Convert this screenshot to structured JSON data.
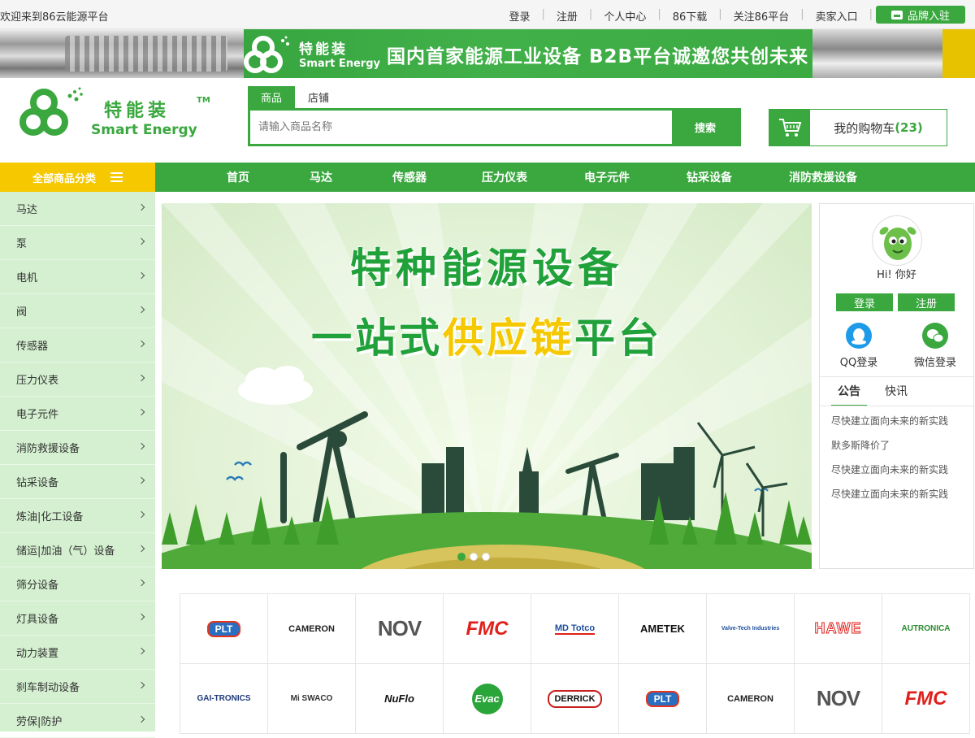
{
  "topbar": {
    "welcome": "欢迎来到86云能源平台",
    "links": [
      "登录",
      "注册",
      "个人中心",
      "86下载",
      "关注86平台",
      "卖家入口"
    ],
    "brand_join": "品牌入驻"
  },
  "top_banner": {
    "brand_cn": "特能装",
    "brand_en": "Smart Energy",
    "slogan": "国内首家能源工业设备 B2B平台诚邀您共创未来"
  },
  "logo": {
    "brand_cn": "特能装",
    "brand_en": "Smart Energy",
    "tm": "TM"
  },
  "search": {
    "tabs": [
      "商品",
      "店铺"
    ],
    "active_tab": 0,
    "placeholder": "请输入商品名称",
    "button": "搜索"
  },
  "cart": {
    "label": "我的购物车",
    "count": "(23)"
  },
  "nav": {
    "all_categories": "全部商品分类",
    "items": [
      "首页",
      "马达",
      "传感器",
      "压力仪表",
      "电子元件",
      "钻采设备",
      "消防救援设备"
    ]
  },
  "sidebar": {
    "categories": [
      "马达",
      "泵",
      "电机",
      "阀",
      "传感器",
      "压力仪表",
      "电子元件",
      "消防救援设备",
      "钻采设备",
      "炼油|化工设备",
      "储运|加油（气）设备",
      "筛分设备",
      "灯具设备",
      "动力装置",
      "刹车制动设备",
      "劳保|防护"
    ]
  },
  "hero": {
    "title_line1": "特种能源设备",
    "title_line2_a": "一站式",
    "title_line2_b": "供应链",
    "title_line2_c": "平台",
    "slides": 3,
    "active_slide": 0
  },
  "user_panel": {
    "greeting": "Hi!  你好",
    "login": "登录",
    "register": "注册",
    "qq_login": "QQ登录",
    "wechat_login": "微信登录",
    "tabs": [
      "公告",
      "快讯"
    ],
    "news": [
      "尽快建立面向未来的新实践",
      "默多斯降价了",
      "尽快建立面向未来的新实践",
      "尽快建立面向未来的新实践"
    ]
  },
  "brands": [
    {
      "name": "PLT",
      "color": "#e8341c"
    },
    {
      "name": "CAMERON",
      "color": "#222222"
    },
    {
      "name": "NOV",
      "color": "#555555"
    },
    {
      "name": "FMC",
      "color": "#e0201b"
    },
    {
      "name": "MD Totco",
      "color": "#1f4e9c"
    },
    {
      "name": "AMETEK",
      "color": "#111111"
    },
    {
      "name": "Valve-Tech Industries",
      "color": "#1f4e9c"
    },
    {
      "name": "HAWE",
      "color": "#e0201b"
    },
    {
      "name": "AUTRONICA",
      "color": "#2a8a2e"
    },
    {
      "name": "GAI-TRONICS",
      "color": "#1f3a7a"
    },
    {
      "name": "Mi SWACO",
      "color": "#333333"
    },
    {
      "name": "NuFlo",
      "color": "#111111"
    },
    {
      "name": "Evac",
      "color": "#2aa53a"
    },
    {
      "name": "DERRICK",
      "color": "#c81e1e"
    },
    {
      "name": "PLT",
      "color": "#e8341c"
    },
    {
      "name": "CAMERON",
      "color": "#222222"
    },
    {
      "name": "NOV",
      "color": "#555555"
    },
    {
      "name": "FMC",
      "color": "#e0201b"
    }
  ],
  "colors": {
    "accent": "#3aa83f",
    "yellow": "#f5c800",
    "sidebar_bg": "#d4f0d0"
  }
}
